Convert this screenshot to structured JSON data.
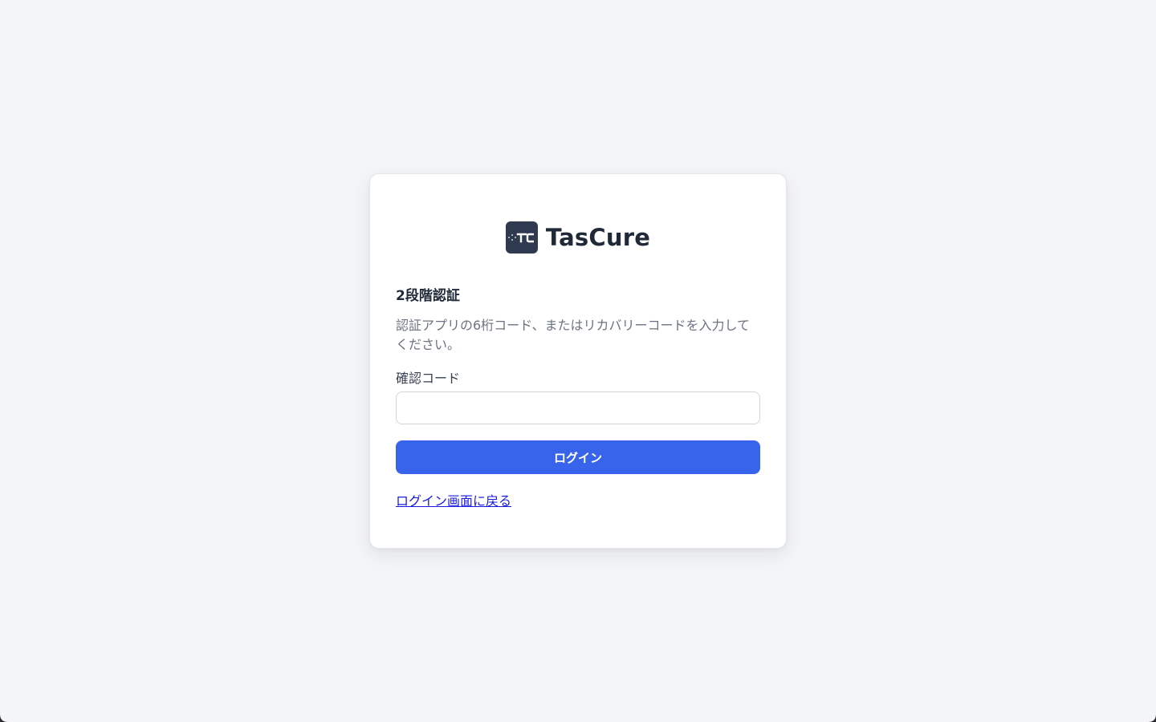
{
  "brand": {
    "name": "TasCure",
    "logo_text": "TC",
    "logo_color": "#2f3a50"
  },
  "form": {
    "heading": "2段階認証",
    "description": "認証アプリの6桁コード、またはリカバリーコードを入力してください。",
    "code_label": "確認コード",
    "code_value": "",
    "code_placeholder": "",
    "submit_label": "ログイン",
    "back_link_label": "ログイン画面に戻る"
  },
  "colors": {
    "background": "#f4f5f7",
    "primary": "#3864ec",
    "link": "#1a1adf"
  }
}
